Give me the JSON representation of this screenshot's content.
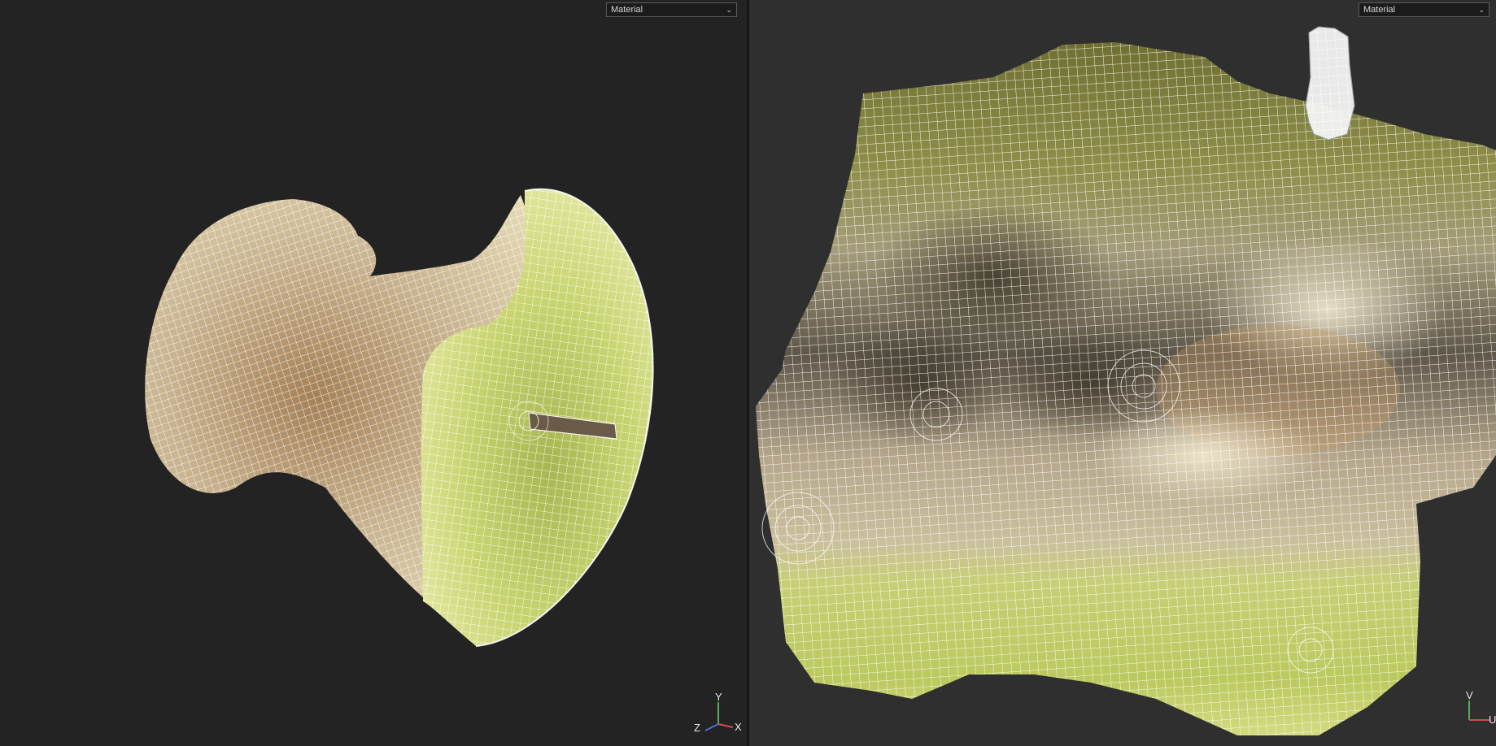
{
  "viewport_3d": {
    "shading_mode": "Material",
    "axis_gizmo": {
      "labels": [
        "Y",
        "Z",
        "X"
      ]
    }
  },
  "viewport_uv": {
    "shading_mode": "Material",
    "axis_gizmo": {
      "labels": [
        "V",
        "U"
      ]
    }
  },
  "colors": {
    "background_3d": "#232323",
    "background_uv": "#2f2f2f",
    "wireframe": "#ffffff",
    "apple_skin": "#c6d36a",
    "apple_flesh": "#b9a27a"
  },
  "icons": [
    "chevron-down-icon",
    "axis-gizmo-icon"
  ]
}
